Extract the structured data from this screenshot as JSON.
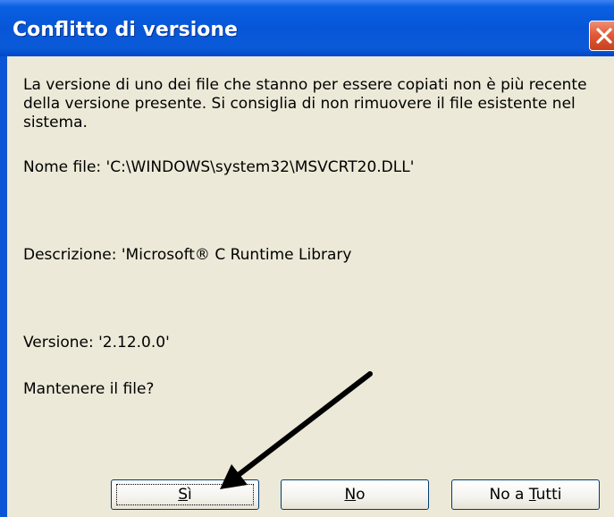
{
  "window": {
    "title": "Conflitto di versione"
  },
  "dialog": {
    "message": "La versione di uno dei file che stanno per essere copiati non è più recente della versione presente. Si consiglia di non rimuovere il file esistente nel sistema.",
    "file_name_line": "Nome file:   'C:\\WINDOWS\\system32\\MSVCRT20.DLL'",
    "description_line": "Descrizione:  'Microsoft® C Runtime Library",
    "version_line": "Versione: '2.12.0.0'",
    "question": "Mantenere il file?"
  },
  "buttons": {
    "yes": {
      "underlined": "S",
      "rest": "ì"
    },
    "no": {
      "underlined": "N",
      "rest": "o"
    },
    "all": {
      "before": "No a ",
      "underlined": "T",
      "rest": "utti"
    }
  },
  "colors": {
    "titlebar": "#0756d8",
    "close_button": "#e25b38",
    "dialog_background": "#ece9d8"
  },
  "annotation": {
    "icon": "arrow-pointer-icon",
    "color": "#000000"
  }
}
